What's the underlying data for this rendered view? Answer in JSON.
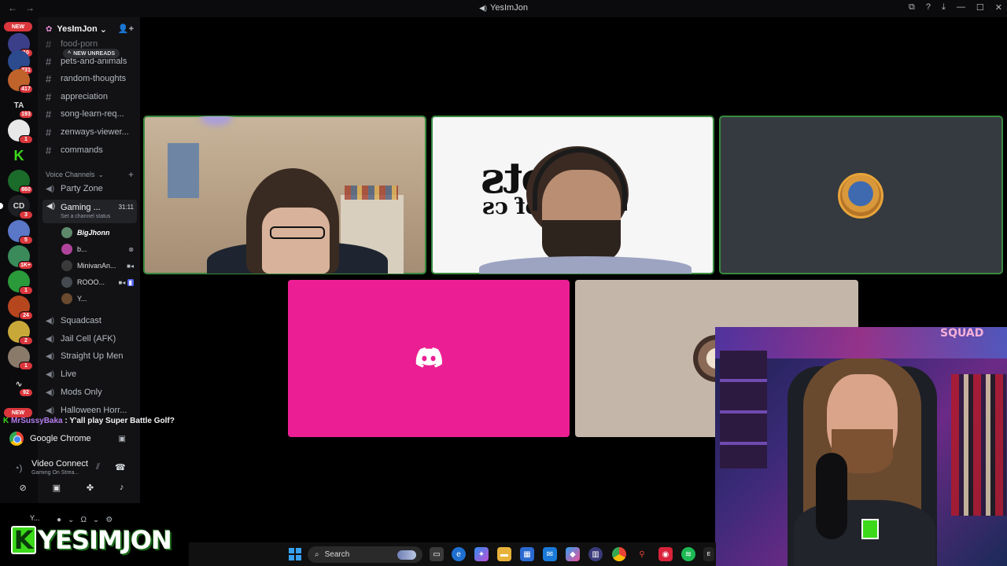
{
  "titlebar": {
    "title": "YesImJon",
    "back": "←",
    "forward": "→",
    "controls": [
      "⧉",
      "?",
      "⤓",
      "—",
      "☐",
      "✕"
    ]
  },
  "server_rail": {
    "new_top": "NEW",
    "new_bottom": "NEW",
    "badges": [
      "10",
      "231",
      "417",
      "193",
      "1",
      "860",
      "3",
      "5",
      "1K+",
      "1",
      "24",
      "2",
      "1",
      "92"
    ],
    "cd_label": "CD",
    "ta_label": "TA"
  },
  "server": {
    "name": "YesImJon",
    "chevron": "⌄",
    "new_unreads": "NEW UNREADS"
  },
  "text_channels": [
    "food-porn",
    "pets-and-animals",
    "random-thoughts",
    "appreciation",
    "song-learn-req...",
    "zenways-viewer...",
    "commands"
  ],
  "voice_category": "Voice Channels",
  "voice_channels_top": [
    "Party Zone"
  ],
  "active_voice": {
    "name": "Gaming ...",
    "timer": "31:11",
    "status": "Set a channel status"
  },
  "voice_users": [
    {
      "name": "BigJhonn",
      "color": "#5e8a6b"
    },
    {
      "name": "b...",
      "color": "#b0449c"
    },
    {
      "name": "MinivanAn...",
      "color": "#3a3a3a"
    },
    {
      "name": "ROOO...",
      "color": "#444a4f"
    },
    {
      "name": "Y...",
      "color": "#6a4a2e"
    }
  ],
  "voice_channels_bottom": [
    "Squadcast",
    "Jail Cell (AFK)",
    "Straight Up Men",
    "Live",
    "Mods Only",
    "Halloween Horr..."
  ],
  "chat_toast": {
    "user": "MrSussyBaka",
    "message": " : Y'all play Super Battle Golf?"
  },
  "stream_app": "Google Chrome",
  "voice_panel": {
    "status": "Video Connected",
    "channel": "Gaming On Strea..."
  },
  "user_area": {
    "name": "Y..."
  },
  "brand": {
    "k": "K",
    "text": "YESIMJON"
  },
  "facecam": {
    "sign": "SQUAD"
  },
  "cam2_sign": {
    "line1": "rots",
    "line2": "of cs"
  },
  "taskbar": {
    "search_placeholder": "Search"
  },
  "colors": {
    "discord_tile": "#eb1f93",
    "speaking_outline": "#3a8a3e",
    "badge": "#da373c"
  }
}
